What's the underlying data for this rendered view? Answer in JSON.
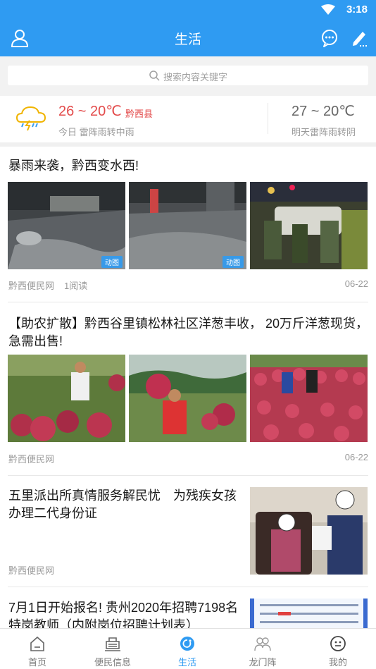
{
  "status_bar": {
    "time": "3:18"
  },
  "header": {
    "title": "生活"
  },
  "search": {
    "placeholder": "搜索内容关键字"
  },
  "weather": {
    "today_temp": "26 ~ 20℃",
    "location": "黔西县",
    "today_desc": "今日 雷阵雨转中雨",
    "tomorrow_temp": "27 ~ 20℃",
    "tomorrow_desc": "明天雷阵雨转阴"
  },
  "articles": [
    {
      "title": "暴雨来袭，黔西变水西!",
      "source": "黔西便民网",
      "reads": "1阅读",
      "date": "06-22",
      "badges": [
        "动图",
        "动图"
      ]
    },
    {
      "title": "【助农扩散】黔西谷里镇松林社区洋葱丰收， 20万斤洋葱现货，急需出售!",
      "source": "黔西便民网",
      "date": "06-22"
    },
    {
      "title": "五里派出所真情服务解民忧　为残疾女孩办理二代身份证",
      "source": "黔西便民网"
    },
    {
      "title": "7月1日开始报名! 贵州2020年招聘7198名特岗教师（内附岗位招聘计划表）"
    }
  ],
  "tabs": [
    {
      "label": "首页",
      "icon": "home-icon"
    },
    {
      "label": "便民信息",
      "icon": "info-icon"
    },
    {
      "label": "生活",
      "icon": "life-icon",
      "active": true
    },
    {
      "label": "龙门阵",
      "icon": "community-icon"
    },
    {
      "label": "我的",
      "icon": "me-icon"
    }
  ],
  "colors": {
    "primary": "#2f9bf2",
    "temp_today": "#e34b4b"
  }
}
